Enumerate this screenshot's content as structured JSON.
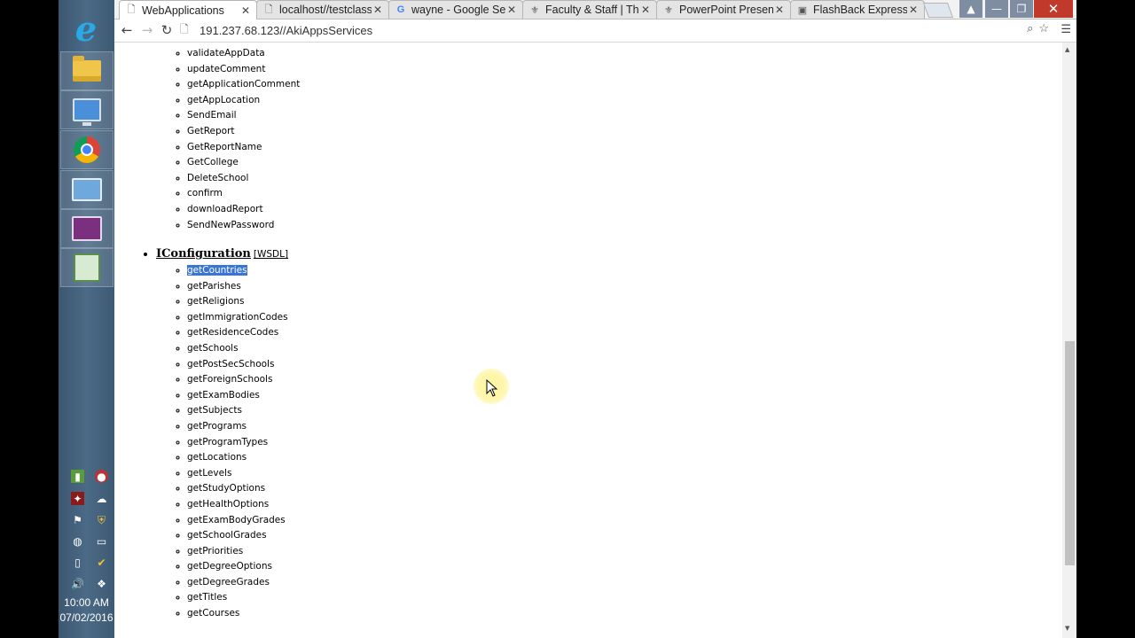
{
  "taskbar": {
    "clock_time": "10:00 AM",
    "clock_date": "07/02/2016",
    "apps": [
      "internet-explorer",
      "file-explorer",
      "network-computer",
      "google-chrome",
      "remote-desktop",
      "presentation",
      "photo-viewer"
    ]
  },
  "tabs": [
    {
      "label": "WebApplications",
      "icon": "page-icon"
    },
    {
      "label": "localhost//testclass.p",
      "icon": "page-icon"
    },
    {
      "label": "wayne - Google Sea",
      "icon": "google-icon"
    },
    {
      "label": "Faculty & Staff | The",
      "icon": "faculty-icon"
    },
    {
      "label": "PowerPoint Presenta",
      "icon": "powerpoint-icon"
    },
    {
      "label": "FlashBack Express de",
      "icon": "flashback-icon"
    }
  ],
  "address_bar": {
    "url": "191.237.68.123//AkiAppsServices"
  },
  "service_methods_top": [
    "validateAppData",
    "updateComment",
    "getApplicationComment",
    "getAppLocation",
    "SendEmail",
    "GetReport",
    "GetReportName",
    "GetCollege",
    "DeleteSchool",
    "confirm",
    "downloadReport",
    "SendNewPassword"
  ],
  "configuration_interface": {
    "name": "IConfiguration",
    "wsdl_label": "[WSDL]",
    "methods": [
      "getCountries",
      "getParishes",
      "getReligions",
      "getImmigrationCodes",
      "getResidenceCodes",
      "getSchools",
      "getPostSecSchools",
      "getForeignSchools",
      "getExamBodies",
      "getSubjects",
      "getPrograms",
      "getProgramTypes",
      "getLocations",
      "getLevels",
      "getStudyOptions",
      "getHealthOptions",
      "getExamBodyGrades",
      "getSchoolGrades",
      "getPriorities",
      "getDegreeOptions",
      "getDegreeGrades",
      "getTitles",
      "getCourses"
    ],
    "selected_method": "getCountries"
  },
  "colors": {
    "selection": "#3875d7",
    "taskbar": "#4b6a86",
    "close_button": "#c0392b"
  }
}
